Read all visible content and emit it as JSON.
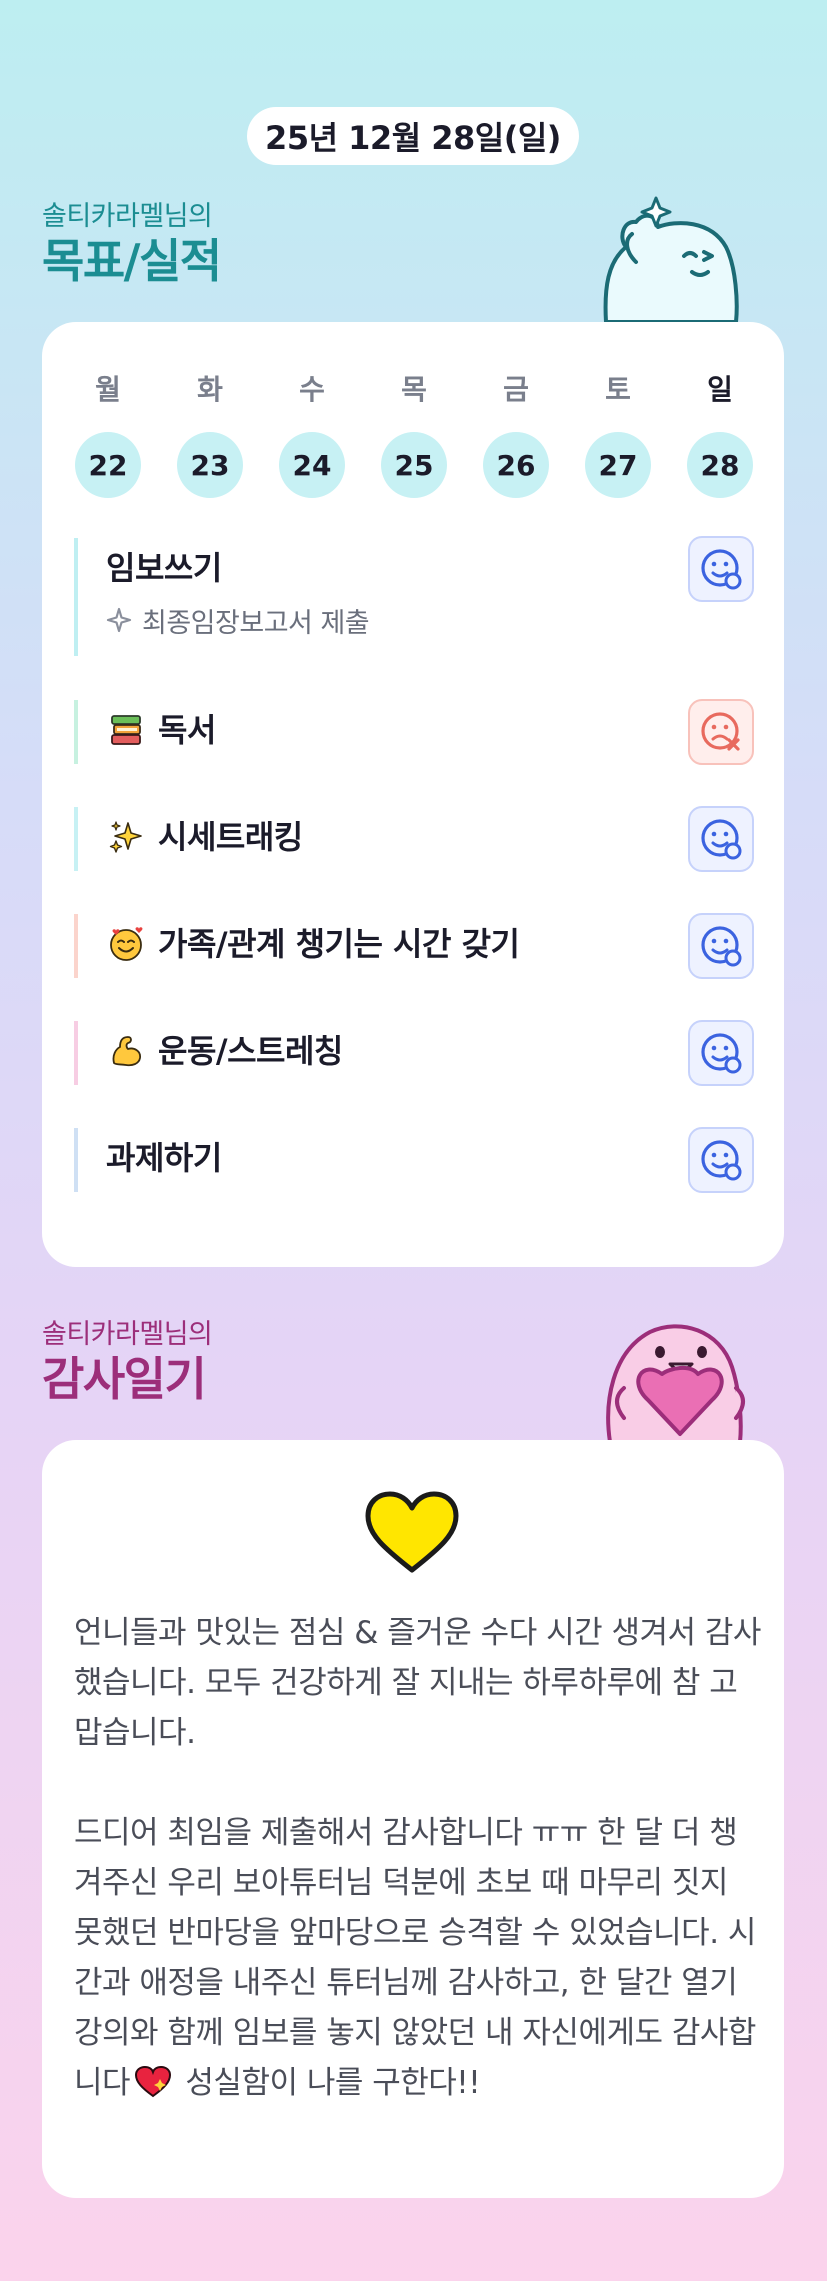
{
  "header": {
    "date": "25년 12월 28일(일)"
  },
  "goals_section": {
    "owner": "솔티카라멜님의",
    "title": "목표/실적",
    "mascot_icon": "ghost-cheering-icon"
  },
  "week": {
    "days": [
      {
        "name": "월",
        "num": "22"
      },
      {
        "name": "화",
        "num": "23"
      },
      {
        "name": "수",
        "num": "24"
      },
      {
        "name": "목",
        "num": "25"
      },
      {
        "name": "금",
        "num": "26"
      },
      {
        "name": "토",
        "num": "27"
      },
      {
        "name": "일",
        "num": "28"
      }
    ],
    "selected_color": "#c7f1f4"
  },
  "goals": [
    {
      "title": "임보쓰기",
      "emoji_icon": "",
      "sub": "최종임장보고서 제출",
      "status": "done"
    },
    {
      "title": "독서",
      "emoji_icon": "books-icon",
      "status": "missed"
    },
    {
      "title": "시세트래킹",
      "emoji_icon": "sparkles-icon",
      "status": "done"
    },
    {
      "title": "가족/관계 챙기는 시간 갖기",
      "emoji_icon": "smiling-face-hearts-icon",
      "status": "done"
    },
    {
      "title": "운동/스트레칭",
      "emoji_icon": "flexed-biceps-icon",
      "status": "done"
    },
    {
      "title": "과제하기",
      "emoji_icon": "",
      "status": "done"
    }
  ],
  "gratitude_section": {
    "owner": "솔티카라멜님의",
    "title": "감사일기",
    "mascot_icon": "ghost-holding-heart-icon",
    "heart_icon": "yellow-heart-icon",
    "paragraphs": [
      "언니들과 맛있는 점심 & 즐거운 수다 시간 생겨서 감사했습니다. 모두 건강하게 잘 지내는 하루하루에 참 고맙습니다.",
      "드디어 최임을 제출해서 감사합니다 ㅠㅠ 한 달 더 챙겨주신 우리 보아튜터님 덕분에 초보 때 마무리 짓지 못했던 반마당을 앞마당으로 승격할 수 있었습니다. 시간과 애정을 내주신 튜터님께 감사하고, 한 달간 열기 강의와 함께 임보를 놓지 않았던 내 자신에게도 감사합니다"
    ],
    "para2_tail": " 성실함이 나를 구한다!!"
  },
  "colors": {
    "goal_accent": "#1b8d92",
    "gratitude_accent": "#9c2e7a",
    "done_face": "#3b63e0",
    "missed_face": "#e86a5e"
  }
}
